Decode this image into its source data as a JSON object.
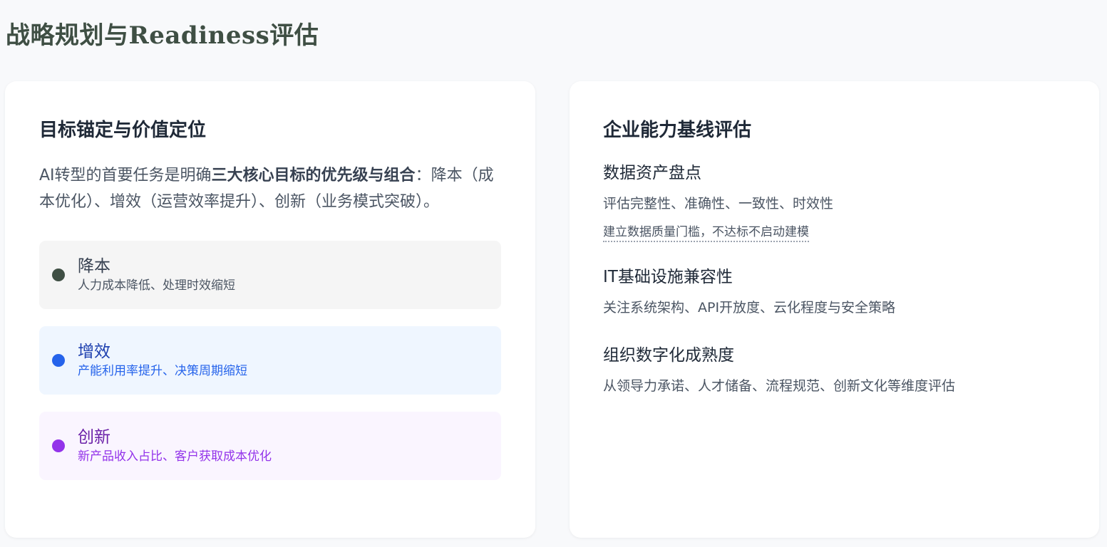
{
  "page": {
    "title": "战略规划与Readiness评估"
  },
  "left_card": {
    "title": "目标锚定与价值定位",
    "intro_before": "AI转型的首要任务是明确",
    "intro_bold": "三大核心目标的优先级与组合",
    "intro_after": "：降本（成本优化）、增效（运营效率提升）、创新（业务模式突破）。",
    "goals": [
      {
        "label": "降本",
        "desc": "人力成本降低、处理时效缩短",
        "dot_color": "#3f4f44",
        "bg_color": "#f5f5f5",
        "label_color": "#374151",
        "desc_color": "#4b5563"
      },
      {
        "label": "增效",
        "desc": "产能利用率提升、决策周期缩短",
        "dot_color": "#2563eb",
        "bg_color": "#eff6ff",
        "label_color": "#1e40af",
        "desc_color": "#2563eb"
      },
      {
        "label": "创新",
        "desc": "新产品收入占比、客户获取成本优化",
        "dot_color": "#9333ea",
        "bg_color": "#faf5ff",
        "label_color": "#6b21a8",
        "desc_color": "#9333ea"
      }
    ]
  },
  "right_card": {
    "title": "企业能力基线评估",
    "sections": [
      {
        "title": "数据资产盘点",
        "desc": "评估完整性、准确性、一致性、时效性",
        "note": "建立数据质量门槛，不达标不启动建模"
      },
      {
        "title": "IT基础设施兼容性",
        "desc": "关注系统架构、API开放度、云化程度与安全策略"
      },
      {
        "title": "组织数字化成熟度",
        "desc": "从领导力承诺、人才储备、流程规范、创新文化等维度评估"
      }
    ]
  }
}
